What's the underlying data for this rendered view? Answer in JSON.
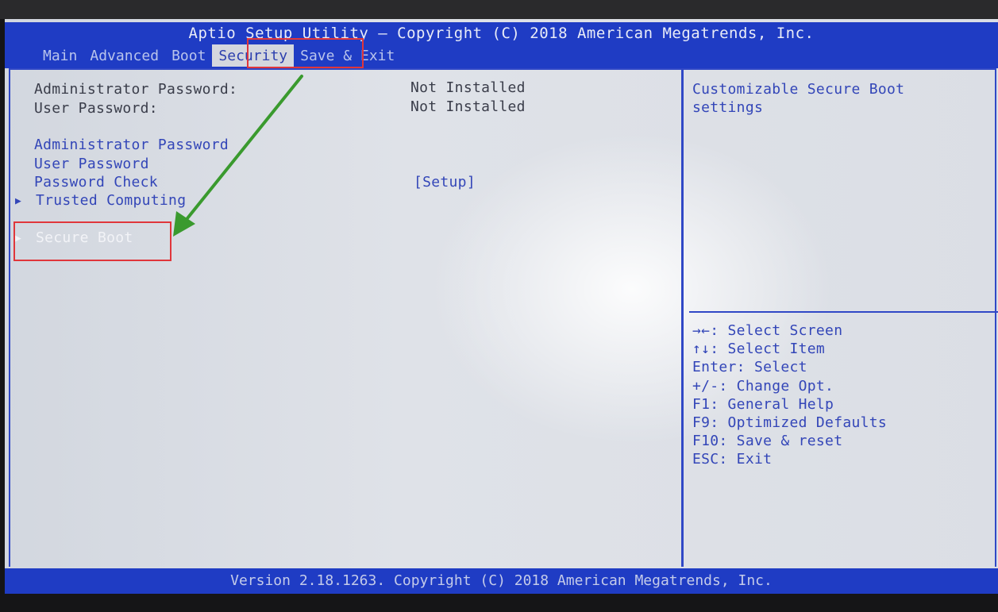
{
  "app": {
    "title": "Aptio Setup Utility – Copyright (C) 2018 American Megatrends, Inc.",
    "tabs": [
      {
        "label": "Main"
      },
      {
        "label": "Advanced"
      },
      {
        "label": "Boot"
      },
      {
        "label": "Security"
      },
      {
        "label": "Save & Exit"
      }
    ],
    "active_tab": "Security"
  },
  "security": {
    "admin_password_label": "Administrator Password:",
    "admin_password_value": "Not Installed",
    "user_password_label": "User Password:",
    "user_password_value": "Not Installed",
    "items": [
      {
        "label": "Administrator Password"
      },
      {
        "label": "User Password"
      },
      {
        "label": "Password Check",
        "value": "[Setup]"
      },
      {
        "label": "Trusted Computing",
        "arrow": "▶"
      },
      {
        "label": "Secure Boot",
        "arrow": "▶"
      }
    ],
    "selected_item": "Secure Boot"
  },
  "help": {
    "description": [
      "Customizable Secure Boot",
      "settings"
    ],
    "keys": [
      "→←: Select Screen",
      "↑↓: Select Item",
      "Enter: Select",
      "+/-: Change Opt.",
      "F1: General Help",
      "F9: Optimized Defaults",
      "F10: Save & reset",
      "ESC: Exit"
    ]
  },
  "footer": {
    "version": "Version 2.18.1263. Copyright (C) 2018 American Megatrends, Inc."
  },
  "colors": {
    "bios_blue": "#1f3cc4",
    "panel_bg": "#dfe2e8",
    "annotation_red": "#e0363b",
    "annotation_green": "#3a9a2e"
  }
}
